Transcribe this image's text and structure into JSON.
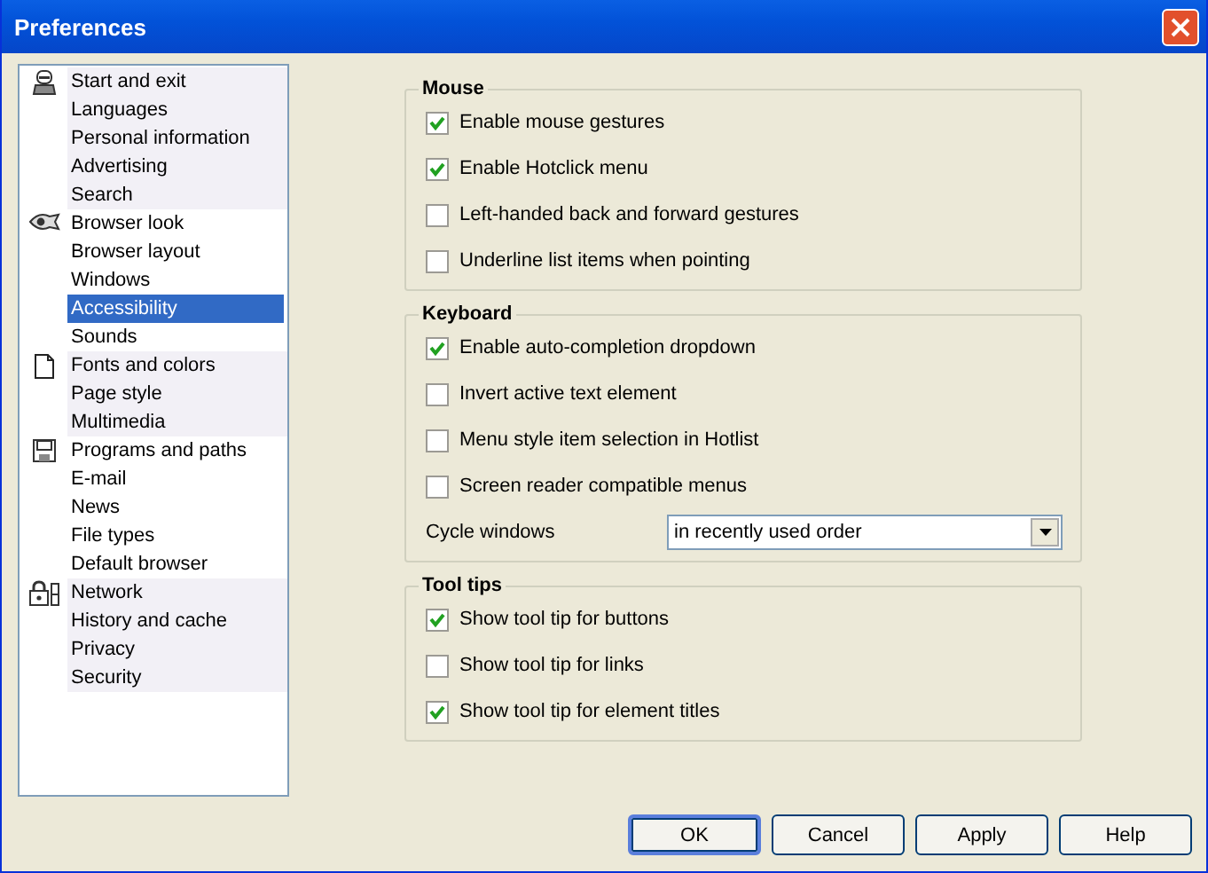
{
  "window": {
    "title": "Preferences"
  },
  "sidebar": {
    "groups": [
      {
        "items": [
          {
            "label": "Start and exit",
            "selected": false
          },
          {
            "label": "Languages",
            "selected": false
          },
          {
            "label": "Personal information",
            "selected": false
          },
          {
            "label": "Advertising",
            "selected": false
          },
          {
            "label": "Search",
            "selected": false
          }
        ]
      },
      {
        "items": [
          {
            "label": "Browser look",
            "selected": false
          },
          {
            "label": "Browser layout",
            "selected": false
          },
          {
            "label": "Windows",
            "selected": false
          },
          {
            "label": "Accessibility",
            "selected": true
          },
          {
            "label": "Sounds",
            "selected": false
          }
        ]
      },
      {
        "items": [
          {
            "label": "Fonts and colors",
            "selected": false
          },
          {
            "label": "Page style",
            "selected": false
          },
          {
            "label": "Multimedia",
            "selected": false
          }
        ]
      },
      {
        "items": [
          {
            "label": "Programs and paths",
            "selected": false
          },
          {
            "label": "E-mail",
            "selected": false
          },
          {
            "label": "News",
            "selected": false
          },
          {
            "label": "File types",
            "selected": false
          },
          {
            "label": "Default browser",
            "selected": false
          }
        ]
      },
      {
        "items": [
          {
            "label": "Network",
            "selected": false
          },
          {
            "label": "History and cache",
            "selected": false
          },
          {
            "label": "Privacy",
            "selected": false
          },
          {
            "label": "Security",
            "selected": false
          }
        ]
      }
    ]
  },
  "groups": [
    {
      "title": "Mouse",
      "rows": [
        {
          "kind": "checkbox",
          "label": "Enable mouse gestures",
          "checked": true
        },
        {
          "kind": "checkbox",
          "label": "Enable Hotclick menu",
          "checked": true
        },
        {
          "kind": "checkbox",
          "label": "Left-handed back and forward gestures",
          "checked": false
        },
        {
          "kind": "checkbox",
          "label": "Underline list items when pointing",
          "checked": false
        }
      ]
    },
    {
      "title": "Keyboard",
      "rows": [
        {
          "kind": "checkbox",
          "label": "Enable auto-completion dropdown",
          "checked": true
        },
        {
          "kind": "checkbox",
          "label": "Invert active text element",
          "checked": false
        },
        {
          "kind": "checkbox",
          "label": "Menu style item selection in Hotlist",
          "checked": false
        },
        {
          "kind": "checkbox",
          "label": "Screen reader compatible menus",
          "checked": false
        },
        {
          "kind": "dropdown",
          "label": "Cycle windows",
          "value": "in recently used order"
        }
      ]
    },
    {
      "title": "Tool tips",
      "rows": [
        {
          "kind": "checkbox",
          "label": "Show tool tip for buttons",
          "checked": true
        },
        {
          "kind": "checkbox",
          "label": "Show tool tip for links",
          "checked": false
        },
        {
          "kind": "checkbox",
          "label": "Show tool tip for element titles",
          "checked": true
        }
      ]
    }
  ],
  "buttons": [
    {
      "label": "OK",
      "default": true
    },
    {
      "label": "Cancel",
      "default": false
    },
    {
      "label": "Apply",
      "default": false
    },
    {
      "label": "Help",
      "default": false
    }
  ]
}
